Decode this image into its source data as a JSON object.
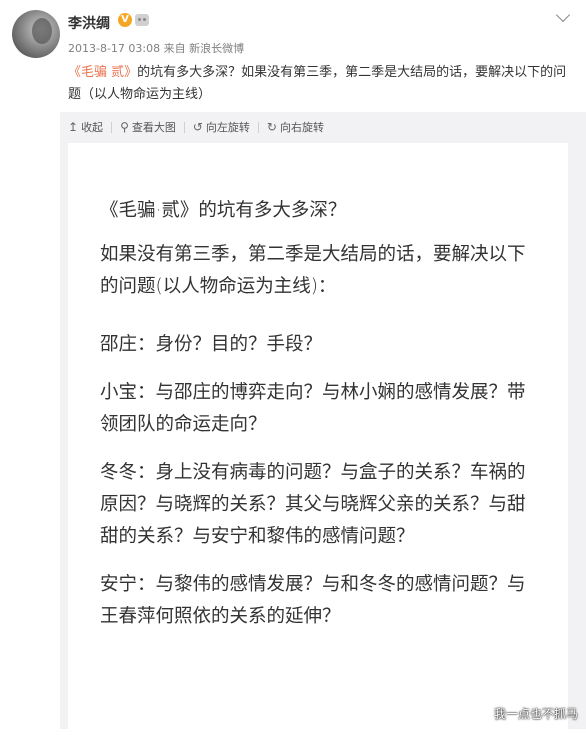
{
  "user": {
    "name": "李洪绸",
    "badge": "V",
    "meta": "2013-8-17 03:08 来自 新浪长微博"
  },
  "post": {
    "highlight": "《毛骗 贰》",
    "text_rest": "的坑有多大多深？如果没有第三季，第二季是大结局的话，要解决以下的问题（以人物命运为主线）"
  },
  "toolbar": {
    "collapse_label": "收起",
    "view_large_label": "查看大图",
    "rotate_left_label": "向左旋转",
    "rotate_right_label": "向右旋转"
  },
  "image": {
    "paragraphs": [
      "《毛骗·贰》的坑有多大多深？",
      "如果没有第三季，第二季是大结局的话，要解决以下的问题(以人物命运为主线)：",
      "邵庄：身份？目的？手段？",
      "小宝：与邵庄的博弈走向？与林小娴的感情发展？带领团队的命运走向？",
      "冬冬：身上没有病毒的问题？与盒子的关系？车祸的原因？与晓辉的关系？其父与晓辉父亲的关系？与甜甜的关系？与安宁和黎伟的感情问题？",
      "安宁：与黎伟的感情发展？与和冬冬的感情问题？与王春萍何照依的关系的延伸？"
    ]
  },
  "watermark": "我一点也不抓马"
}
